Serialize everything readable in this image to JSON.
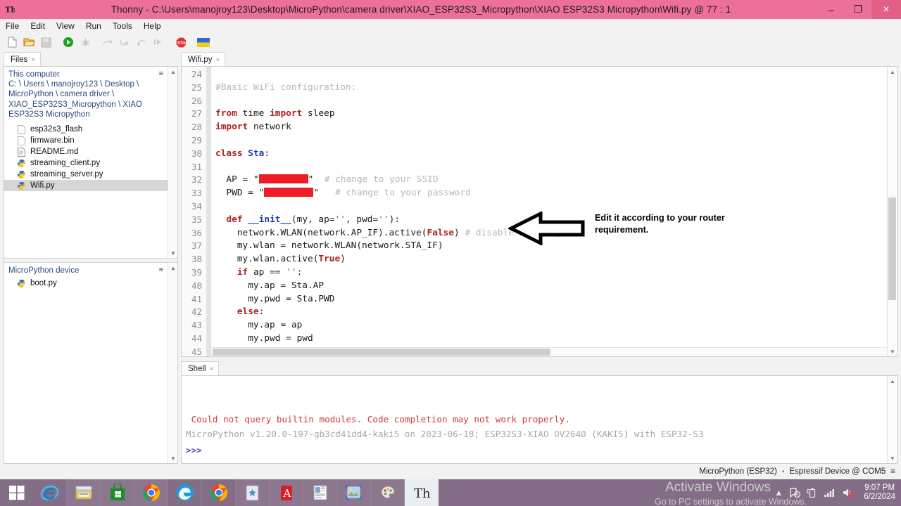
{
  "window": {
    "app_icon": "thonny-icon",
    "title": "Thonny  -  C:\\Users\\manojroy123\\Desktop\\MicroPython\\camera driver\\XIAO_ESP32S3_Micropython\\XIAO ESP32S3 Micropython\\Wifi.py  @  77 : 1",
    "minimize": "–",
    "maximize": "❐",
    "close": "×",
    "titlebar_color": "#ec7099"
  },
  "menu": {
    "items": [
      "File",
      "Edit",
      "View",
      "Run",
      "Tools",
      "Help"
    ]
  },
  "toolbar": {
    "items": [
      {
        "name": "new-file-icon",
        "title": "New"
      },
      {
        "name": "open-file-icon",
        "title": "Open"
      },
      {
        "name": "save-file-icon",
        "title": "Save"
      },
      {
        "name": "run-icon",
        "title": "Run current script"
      },
      {
        "name": "debug-icon",
        "title": "Debug current script"
      },
      {
        "name": "step-over-icon",
        "title": "Step over"
      },
      {
        "name": "step-into-icon",
        "title": "Step into"
      },
      {
        "name": "step-out-icon",
        "title": "Step out"
      },
      {
        "name": "resume-icon",
        "title": "Resume"
      },
      {
        "name": "stop-icon",
        "title": "Stop/Restart backend"
      },
      {
        "name": "ukraine-flag-icon",
        "title": "Support Ukraine"
      }
    ]
  },
  "files_pane": {
    "tab_label": "Files",
    "tab_close": "×",
    "menu_glyph": "≡",
    "this_computer": "This computer",
    "breadcrumb": "C: \\ Users \\ manojroy123 \\ Desktop \\ MicroPython \\ camera driver \\ XIAO_ESP32S3_Micropython \\ XIAO ESP32S3 Micropython",
    "files": [
      {
        "name": "esp32s3_flash",
        "icon": "blank-file-icon",
        "selected": false
      },
      {
        "name": "firmware.bin",
        "icon": "blank-file-icon",
        "selected": false
      },
      {
        "name": "README.md",
        "icon": "text-file-icon",
        "selected": false
      },
      {
        "name": "streaming_client.py",
        "icon": "python-file-icon",
        "selected": false
      },
      {
        "name": "streaming_server.py",
        "icon": "python-file-icon",
        "selected": false
      },
      {
        "name": "Wifi.py",
        "icon": "python-file-icon",
        "selected": true
      }
    ],
    "device_title": "MicroPython device",
    "device_menu_glyph": "≡",
    "device_files": [
      {
        "name": "boot.py",
        "icon": "python-file-icon"
      }
    ]
  },
  "editor": {
    "tab_label": "Wifi.py",
    "tab_close": "×",
    "first_visible_line_number": 24,
    "lines": [
      {
        "num": 24,
        "segments": []
      },
      {
        "num": 25,
        "segments": [
          {
            "t": "#Basic WiFi configuration:",
            "c": "cmt"
          }
        ]
      },
      {
        "num": 26,
        "segments": []
      },
      {
        "num": 27,
        "segments": [
          {
            "t": "from",
            "c": "kw"
          },
          {
            "t": " time ",
            "c": "pln"
          },
          {
            "t": "import",
            "c": "kw"
          },
          {
            "t": " sleep",
            "c": "pln"
          }
        ]
      },
      {
        "num": 28,
        "segments": [
          {
            "t": "import",
            "c": "kw"
          },
          {
            "t": " network",
            "c": "pln"
          }
        ]
      },
      {
        "num": 29,
        "segments": []
      },
      {
        "num": 30,
        "segments": [
          {
            "t": "class",
            "c": "kw"
          },
          {
            "t": " ",
            "c": "pln"
          },
          {
            "t": "Sta",
            "c": "cls"
          },
          {
            "t": ":",
            "c": "pln"
          }
        ]
      },
      {
        "num": 31,
        "segments": []
      },
      {
        "num": 32,
        "segments": [
          {
            "t": "  AP = \"",
            "c": "pln"
          },
          {
            "t": "",
            "c": "redact",
            "w": 70
          },
          {
            "t": "\"  ",
            "c": "pln"
          },
          {
            "t": "# change to your SSID",
            "c": "cmt"
          }
        ]
      },
      {
        "num": 33,
        "segments": [
          {
            "t": "  PWD = \"",
            "c": "pln"
          },
          {
            "t": "",
            "c": "redact",
            "w": 70
          },
          {
            "t": "\"   ",
            "c": "pln"
          },
          {
            "t": "# change to your password",
            "c": "cmt"
          }
        ]
      },
      {
        "num": 34,
        "segments": []
      },
      {
        "num": 35,
        "segments": [
          {
            "t": "  ",
            "c": "pln"
          },
          {
            "t": "def",
            "c": "kw"
          },
          {
            "t": " ",
            "c": "pln"
          },
          {
            "t": "__init__",
            "c": "cls"
          },
          {
            "t": "(my, ap=",
            "c": "pln"
          },
          {
            "t": "''",
            "c": "str"
          },
          {
            "t": ", pwd=",
            "c": "pln"
          },
          {
            "t": "''",
            "c": "str"
          },
          {
            "t": "):",
            "c": "pln"
          }
        ]
      },
      {
        "num": 36,
        "segments": [
          {
            "t": "    network.WLAN(network.AP_IF).active(",
            "c": "pln"
          },
          {
            "t": "False",
            "c": "bi"
          },
          {
            "t": ") ",
            "c": "pln"
          },
          {
            "t": "# disable access point",
            "c": "cmt"
          }
        ]
      },
      {
        "num": 37,
        "segments": [
          {
            "t": "    my.wlan = network.WLAN(network.STA_IF)",
            "c": "pln"
          }
        ]
      },
      {
        "num": 38,
        "segments": [
          {
            "t": "    my.wlan.active(",
            "c": "pln"
          },
          {
            "t": "True",
            "c": "bi"
          },
          {
            "t": ")",
            "c": "pln"
          }
        ]
      },
      {
        "num": 39,
        "segments": [
          {
            "t": "    ",
            "c": "pln"
          },
          {
            "t": "if",
            "c": "kw"
          },
          {
            "t": " ap == ",
            "c": "pln"
          },
          {
            "t": "''",
            "c": "str"
          },
          {
            "t": ":",
            "c": "pln"
          }
        ]
      },
      {
        "num": 40,
        "segments": [
          {
            "t": "      my.ap = Sta.AP",
            "c": "pln"
          }
        ]
      },
      {
        "num": 41,
        "segments": [
          {
            "t": "      my.pwd = Sta.PWD",
            "c": "pln"
          }
        ]
      },
      {
        "num": 42,
        "segments": [
          {
            "t": "    ",
            "c": "pln"
          },
          {
            "t": "else",
            "c": "kw"
          },
          {
            "t": ":",
            "c": "pln"
          }
        ]
      },
      {
        "num": 43,
        "segments": [
          {
            "t": "      my.ap = ap",
            "c": "pln"
          }
        ]
      },
      {
        "num": 44,
        "segments": [
          {
            "t": "      my.pwd = pwd",
            "c": "pln"
          }
        ]
      },
      {
        "num": 45,
        "segments": []
      }
    ],
    "scroll_up_glyph": "⌃",
    "scroll_down_glyph": "⌄"
  },
  "annotation": {
    "arrow": "left-arrow-annotation",
    "text": "Edit it according to your router requirement."
  },
  "shell": {
    "tab_label": "Shell",
    "tab_close": "×",
    "lines": [
      {
        "text": " Could not query builtin modules. Code completion may not work properly.",
        "style": "sh-err"
      },
      {
        "text": "MicroPython v1.20.0-197-gb3cd41dd4-kaki5 on 2023-06-18; ESP32S3-XIAO OV2640 (KAKI5) with ESP32-S3",
        "style": "sh-dim"
      },
      {
        "text": ">>>",
        "style": "sh-prompt"
      }
    ]
  },
  "watermark": {
    "line1": "Activate Windows",
    "line2": "Go to PC settings to activate Windows."
  },
  "statusbar": {
    "interpreter": "MicroPython (ESP32)",
    "separator": "•",
    "device": "Espressif Device @ COM5",
    "menu_glyph": "≡"
  },
  "taskbar": {
    "start": "windows-start-icon",
    "buttons": [
      {
        "name": "internet-explorer-icon",
        "pinned": false,
        "active": false
      },
      {
        "name": "file-explorer-icon",
        "pinned": true,
        "active": false
      },
      {
        "name": "windows-store-icon",
        "pinned": true,
        "active": false
      },
      {
        "name": "google-chrome-icon",
        "pinned": true,
        "active": false
      },
      {
        "name": "microsoft-edge-icon",
        "pinned": false,
        "active": false
      },
      {
        "name": "chrome-window-icon",
        "pinned": false,
        "active": false
      },
      {
        "name": "sticker-app-icon",
        "pinned": true,
        "active": false
      },
      {
        "name": "adobe-acrobat-icon",
        "pinned": true,
        "active": false
      },
      {
        "name": "document-viewer-icon",
        "pinned": true,
        "active": false
      },
      {
        "name": "photos-icon",
        "pinned": true,
        "active": false
      },
      {
        "name": "paint-icon",
        "pinned": true,
        "active": false
      },
      {
        "name": "thonny-icon",
        "pinned": false,
        "active": true
      }
    ],
    "tray": [
      {
        "name": "show-hidden-icons-chevron"
      },
      {
        "name": "action-center-icon"
      },
      {
        "name": "battery-icon"
      },
      {
        "name": "network-signal-icon"
      },
      {
        "name": "volume-muted-icon"
      }
    ],
    "time": "9:07 PM",
    "date": "6/2/2024",
    "taskbar_color": "#846d86"
  }
}
